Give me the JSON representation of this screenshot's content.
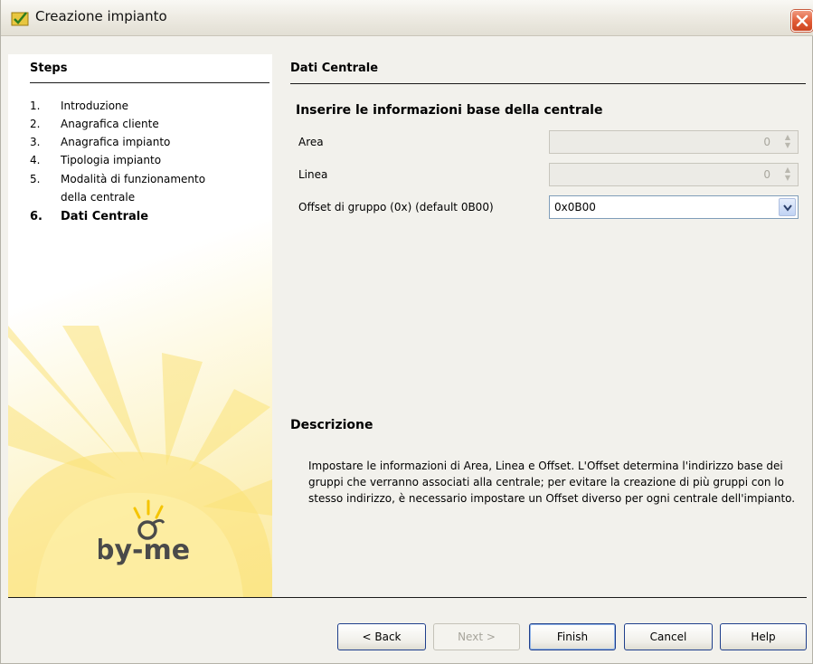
{
  "window": {
    "title": "Creazione impianto"
  },
  "steps": {
    "title": "Steps",
    "items": [
      {
        "num": "1.",
        "label": "Introduzione"
      },
      {
        "num": "2.",
        "label": "Anagrafica cliente"
      },
      {
        "num": "3.",
        "label": "Anagrafica impianto"
      },
      {
        "num": "4.",
        "label": "Tipologia impianto"
      },
      {
        "num": "5.",
        "label": "Modalità di funzionamento",
        "label_cont": "della centrale"
      },
      {
        "num": "6.",
        "label": "Dati Centrale",
        "active": true
      }
    ],
    "logo_text": "by-me"
  },
  "main": {
    "title": "Dati Centrale",
    "subhead": "Inserire le informazioni base della centrale",
    "fields": [
      {
        "label": "Area",
        "value": "0",
        "enabled": false
      },
      {
        "label": "Linea",
        "value": "0",
        "enabled": false
      },
      {
        "label": "Offset di gruppo (0x) (default 0B00)",
        "value": "0x0B00",
        "enabled": true
      }
    ],
    "description_title": "Descrizione",
    "description_text": "Impostare le informazioni di Area, Linea e Offset. L'Offset determina l'indirizzo base dei gruppi che verranno associati alla centrale; per evitare la creazione di più gruppi con lo stesso indirizzo, è necessario impostare un Offset diverso per ogni centrale dell'impianto."
  },
  "buttons": {
    "back": "< Back",
    "next": "Next >",
    "finish": "Finish",
    "cancel": "Cancel",
    "help": "Help"
  },
  "colors": {
    "accent_border": "#1f3f8c",
    "close_button": "#e05a34",
    "logo_yellow": "#f5c400"
  }
}
